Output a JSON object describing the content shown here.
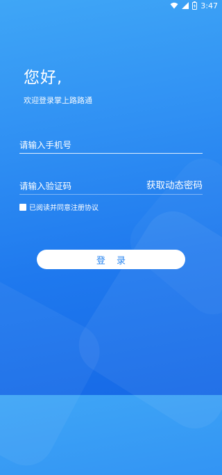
{
  "status_bar": {
    "time": "3:47",
    "icons": [
      "wifi-icon",
      "cell-signal-icon",
      "battery-charging-icon"
    ]
  },
  "header": {
    "greeting": "您好,",
    "welcome": "欢迎登录掌上路路通"
  },
  "form": {
    "phone_placeholder": "请输入手机号",
    "code_placeholder": "请输入验证码",
    "get_code_label": "获取动态密码",
    "agree_text": "已阅读并同意",
    "agreement_link": "注册协议",
    "login_label": "登 录"
  },
  "colors": {
    "background_top": "#3fa6f6",
    "background_bottom": "#1669e6",
    "button_text": "#2a86f0"
  }
}
